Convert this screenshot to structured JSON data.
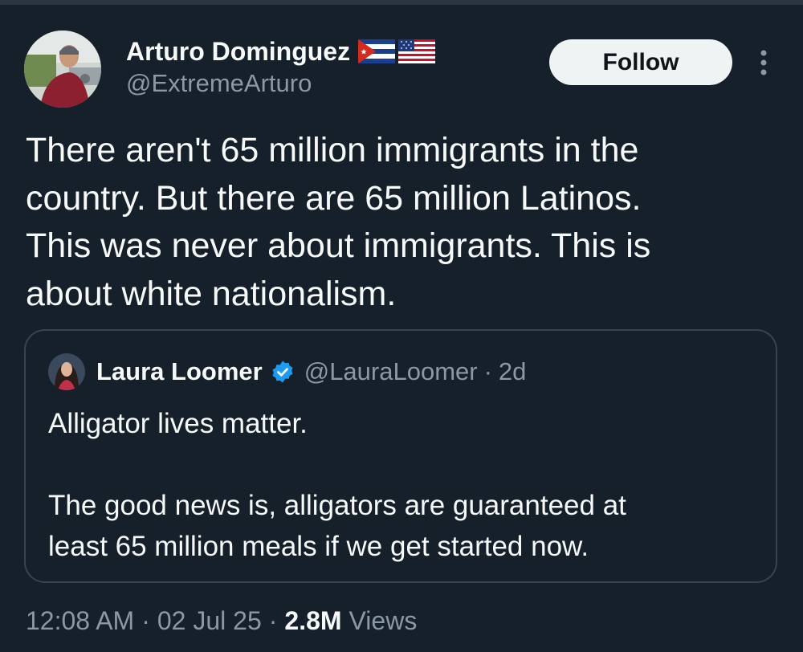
{
  "author": {
    "display_name": "Arturo Dominguez",
    "handle": "@ExtremeArturo",
    "flags": [
      "cuba-flag-icon",
      "usa-flag-icon"
    ]
  },
  "actions": {
    "follow_label": "Follow",
    "more_icon": "more-vertical-icon"
  },
  "tweet": {
    "text": "There aren't 65 million immigrants in the\ncountry. But there are 65 million Latinos.\nThis was never about immigrants. This is\nabout white nationalism."
  },
  "quoted": {
    "display_name": "Laura Loomer",
    "verified_icon": "verified-badge-icon",
    "handle": "@LauraLoomer",
    "separator": "·",
    "time": "2d",
    "text": "Alligator lives matter.\n\nThe good news is, alligators are guaranteed at\nleast 65 million meals if we get started now."
  },
  "meta": {
    "time": "12:08 AM",
    "separator": "·",
    "date": "02 Jul 25",
    "views_count": "2.8M",
    "views_label": "Views"
  },
  "colors": {
    "background": "#15202b",
    "text_primary": "#f7f9f9",
    "text_secondary": "#8b98a5",
    "border": "#38444d",
    "verified": "#1d9bf0",
    "follow_bg": "#eff3f4"
  }
}
